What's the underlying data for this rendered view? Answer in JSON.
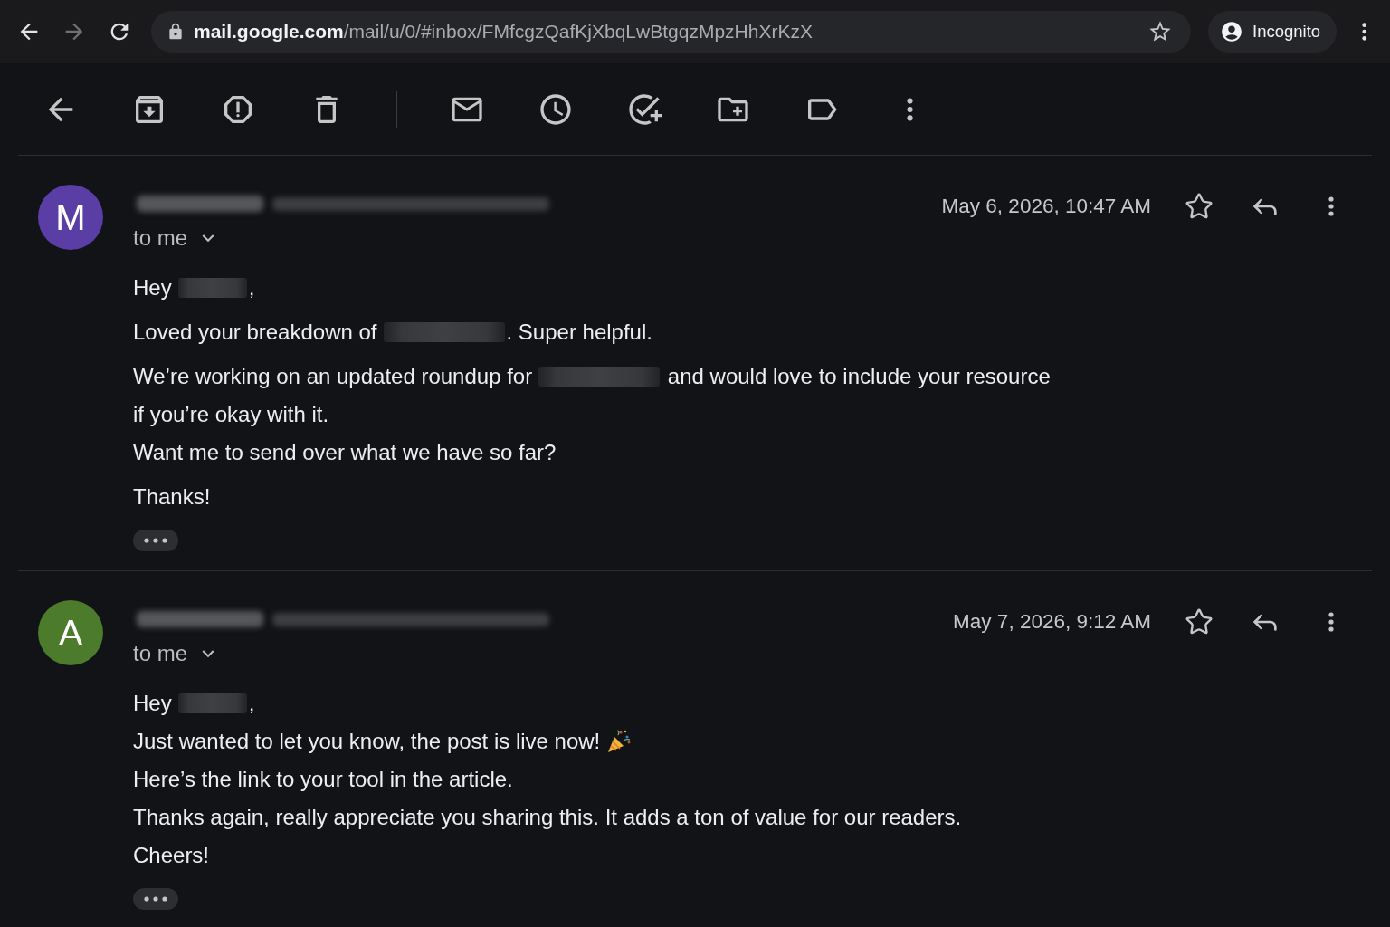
{
  "browser": {
    "nav": [
      {
        "kind": "back",
        "disabled": false
      },
      {
        "kind": "forward",
        "disabled": true
      },
      {
        "kind": "reload",
        "disabled": false
      }
    ],
    "address": {
      "host": "mail.google.com",
      "path": "/mail/u/0/#inbox/FMfcgzQafKjXbqLwBtgqzMpzHhXrKzX"
    },
    "profile": {
      "label": "Incognito"
    }
  },
  "messages": [
    {
      "initial": "M",
      "color": "#5a3ea6",
      "recipient": "to me",
      "date": "May 6, 2026, 10:47 AM",
      "starred": false,
      "paragraphs": [
        {
          "lines": [
            {
              "segments": [
                {
                  "kind": "text",
                  "text": "Hey"
                },
                {
                  "kind": "blur"
                },
                {
                  "kind": "text",
                  "text": ","
                }
              ]
            }
          ]
        },
        {
          "lines": [
            {
              "segments": [
                {
                  "kind": "text",
                  "text": "Loved your breakdown of"
                },
                {
                  "kind": "wideblur"
                },
                {
                  "kind": "text",
                  "text": ". Super helpful."
                }
              ]
            }
          ]
        },
        {
          "lines": [
            {
              "segments": [
                {
                  "kind": "text",
                  "text": "We’re working on an updated roundup for"
                },
                {
                  "kind": "wideblur"
                },
                {
                  "kind": "text",
                  "text": " and would love to include your resource"
                }
              ]
            },
            {
              "segments": [
                {
                  "kind": "text",
                  "text": "if you’re okay with it."
                }
              ]
            },
            {
              "segments": [
                {
                  "kind": "text",
                  "text": "Want me to send over what we have so far?"
                }
              ]
            }
          ]
        },
        {
          "lines": [
            {
              "segments": [
                {
                  "kind": "text",
                  "text": "Thanks!"
                }
              ]
            }
          ]
        }
      ]
    },
    {
      "initial": "A",
      "color": "#4c7b2b",
      "recipient": "to me",
      "date": "May 7, 2026, 9:12 AM",
      "starred": false,
      "paragraphs": [
        {
          "lines": [
            {
              "segments": [
                {
                  "kind": "text",
                  "text": "Hey"
                },
                {
                  "kind": "blur"
                },
                {
                  "kind": "text",
                  "text": ","
                }
              ]
            },
            {
              "segments": [
                {
                  "kind": "text",
                  "text": "Just wanted to let you know, the post is live now!"
                },
                {
                  "kind": "emoji"
                }
              ]
            },
            {
              "segments": [
                {
                  "kind": "text",
                  "text": "Here’s the link to your tool in the article."
                }
              ]
            },
            {
              "segments": [
                {
                  "kind": "text",
                  "text": "Thanks again, really appreciate you sharing this. It adds a ton of value for our readers."
                }
              ]
            },
            {
              "segments": [
                {
                  "kind": "text",
                  "text": "Cheers!"
                }
              ]
            }
          ]
        }
      ]
    }
  ]
}
